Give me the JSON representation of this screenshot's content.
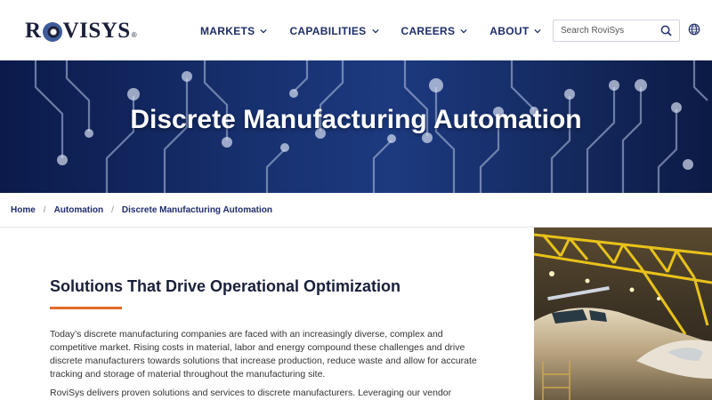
{
  "header": {
    "logo_text": "ROVISYS",
    "nav": [
      {
        "label": "MARKETS"
      },
      {
        "label": "CAPABILITIES"
      },
      {
        "label": "CAREERS"
      },
      {
        "label": "ABOUT"
      }
    ],
    "search_placeholder": "Search RoviSys"
  },
  "hero": {
    "title": "Discrete Manufacturing Automation"
  },
  "breadcrumb": [
    {
      "label": "Home"
    },
    {
      "label": "Automation"
    },
    {
      "label": "Discrete Manufacturing Automation"
    }
  ],
  "main": {
    "section_title": "Solutions That Drive Operational Optimization",
    "paragraph_1": "Today’s discrete manufacturing companies are faced with an increasingly diverse, complex and competitive market. Rising costs in material, labor and energy compound these challenges and drive discrete manufacturers towards solutions that increase production, reduce waste and allow for accurate tracking and storage of material throughout the manufacturing site.",
    "paragraph_2": "RoviSys delivers proven solutions and services to discrete manufacturers. Leveraging our vendor"
  },
  "colors": {
    "brand_navy": "#1f2d6b",
    "accent_orange": "#e56a2a",
    "hero_blue": "#17306e"
  }
}
